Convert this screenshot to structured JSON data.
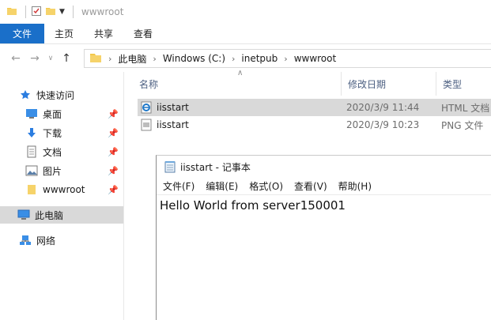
{
  "window": {
    "title": "wwwroot"
  },
  "ribbon": {
    "tabs": [
      "文件",
      "主页",
      "共享",
      "查看"
    ]
  },
  "address": {
    "crumbs": [
      "此电脑",
      "Windows (C:)",
      "inetpub",
      "wwwroot"
    ]
  },
  "nav": {
    "quick_access": "快速访问",
    "items": [
      {
        "label": "桌面",
        "icon": "desktop-icon",
        "pinned": true
      },
      {
        "label": "下载",
        "icon": "download-icon",
        "pinned": true
      },
      {
        "label": "文档",
        "icon": "document-icon",
        "pinned": true
      },
      {
        "label": "图片",
        "icon": "picture-icon",
        "pinned": true
      },
      {
        "label": "wwwroot",
        "icon": "folder-icon",
        "pinned": true
      }
    ],
    "this_pc": "此电脑",
    "network": "网络"
  },
  "columns": {
    "name": "名称",
    "date": "修改日期",
    "type": "类型"
  },
  "files": [
    {
      "name": "iisstart",
      "date": "2020/3/9 11:44",
      "type": "HTML 文档",
      "icon": "html-file-icon"
    },
    {
      "name": "iisstart",
      "date": "2020/3/9 10:23",
      "type": "PNG 文件",
      "icon": "png-file-icon"
    }
  ],
  "notepad": {
    "title": "iisstart - 记事本",
    "menu": [
      "文件(F)",
      "编辑(E)",
      "格式(O)",
      "查看(V)",
      "帮助(H)"
    ],
    "content": "Hello World from server150001"
  },
  "colors": {
    "accent": "#1a6fc9",
    "selection": "#d9d9d9",
    "folder": "#f3c84b"
  }
}
